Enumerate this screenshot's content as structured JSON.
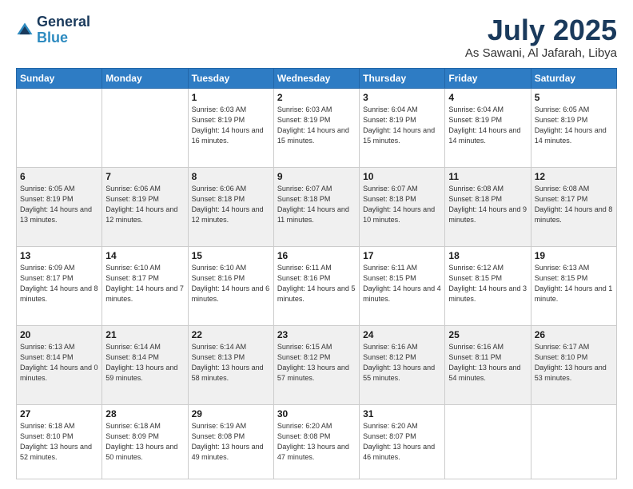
{
  "header": {
    "logo_line1": "General",
    "logo_line2": "Blue",
    "month": "July 2025",
    "location": "As Sawani, Al Jafarah, Libya"
  },
  "days_of_week": [
    "Sunday",
    "Monday",
    "Tuesday",
    "Wednesday",
    "Thursday",
    "Friday",
    "Saturday"
  ],
  "weeks": [
    [
      {
        "day": "",
        "empty": true
      },
      {
        "day": "",
        "empty": true
      },
      {
        "day": "1",
        "sunrise": "Sunrise: 6:03 AM",
        "sunset": "Sunset: 8:19 PM",
        "daylight": "Daylight: 14 hours and 16 minutes."
      },
      {
        "day": "2",
        "sunrise": "Sunrise: 6:03 AM",
        "sunset": "Sunset: 8:19 PM",
        "daylight": "Daylight: 14 hours and 15 minutes."
      },
      {
        "day": "3",
        "sunrise": "Sunrise: 6:04 AM",
        "sunset": "Sunset: 8:19 PM",
        "daylight": "Daylight: 14 hours and 15 minutes."
      },
      {
        "day": "4",
        "sunrise": "Sunrise: 6:04 AM",
        "sunset": "Sunset: 8:19 PM",
        "daylight": "Daylight: 14 hours and 14 minutes."
      },
      {
        "day": "5",
        "sunrise": "Sunrise: 6:05 AM",
        "sunset": "Sunset: 8:19 PM",
        "daylight": "Daylight: 14 hours and 14 minutes."
      }
    ],
    [
      {
        "day": "6",
        "sunrise": "Sunrise: 6:05 AM",
        "sunset": "Sunset: 8:19 PM",
        "daylight": "Daylight: 14 hours and 13 minutes."
      },
      {
        "day": "7",
        "sunrise": "Sunrise: 6:06 AM",
        "sunset": "Sunset: 8:19 PM",
        "daylight": "Daylight: 14 hours and 12 minutes."
      },
      {
        "day": "8",
        "sunrise": "Sunrise: 6:06 AM",
        "sunset": "Sunset: 8:18 PM",
        "daylight": "Daylight: 14 hours and 12 minutes."
      },
      {
        "day": "9",
        "sunrise": "Sunrise: 6:07 AM",
        "sunset": "Sunset: 8:18 PM",
        "daylight": "Daylight: 14 hours and 11 minutes."
      },
      {
        "day": "10",
        "sunrise": "Sunrise: 6:07 AM",
        "sunset": "Sunset: 8:18 PM",
        "daylight": "Daylight: 14 hours and 10 minutes."
      },
      {
        "day": "11",
        "sunrise": "Sunrise: 6:08 AM",
        "sunset": "Sunset: 8:18 PM",
        "daylight": "Daylight: 14 hours and 9 minutes."
      },
      {
        "day": "12",
        "sunrise": "Sunrise: 6:08 AM",
        "sunset": "Sunset: 8:17 PM",
        "daylight": "Daylight: 14 hours and 8 minutes."
      }
    ],
    [
      {
        "day": "13",
        "sunrise": "Sunrise: 6:09 AM",
        "sunset": "Sunset: 8:17 PM",
        "daylight": "Daylight: 14 hours and 8 minutes."
      },
      {
        "day": "14",
        "sunrise": "Sunrise: 6:10 AM",
        "sunset": "Sunset: 8:17 PM",
        "daylight": "Daylight: 14 hours and 7 minutes."
      },
      {
        "day": "15",
        "sunrise": "Sunrise: 6:10 AM",
        "sunset": "Sunset: 8:16 PM",
        "daylight": "Daylight: 14 hours and 6 minutes."
      },
      {
        "day": "16",
        "sunrise": "Sunrise: 6:11 AM",
        "sunset": "Sunset: 8:16 PM",
        "daylight": "Daylight: 14 hours and 5 minutes."
      },
      {
        "day": "17",
        "sunrise": "Sunrise: 6:11 AM",
        "sunset": "Sunset: 8:15 PM",
        "daylight": "Daylight: 14 hours and 4 minutes."
      },
      {
        "day": "18",
        "sunrise": "Sunrise: 6:12 AM",
        "sunset": "Sunset: 8:15 PM",
        "daylight": "Daylight: 14 hours and 3 minutes."
      },
      {
        "day": "19",
        "sunrise": "Sunrise: 6:13 AM",
        "sunset": "Sunset: 8:15 PM",
        "daylight": "Daylight: 14 hours and 1 minute."
      }
    ],
    [
      {
        "day": "20",
        "sunrise": "Sunrise: 6:13 AM",
        "sunset": "Sunset: 8:14 PM",
        "daylight": "Daylight: 14 hours and 0 minutes."
      },
      {
        "day": "21",
        "sunrise": "Sunrise: 6:14 AM",
        "sunset": "Sunset: 8:14 PM",
        "daylight": "Daylight: 13 hours and 59 minutes."
      },
      {
        "day": "22",
        "sunrise": "Sunrise: 6:14 AM",
        "sunset": "Sunset: 8:13 PM",
        "daylight": "Daylight: 13 hours and 58 minutes."
      },
      {
        "day": "23",
        "sunrise": "Sunrise: 6:15 AM",
        "sunset": "Sunset: 8:12 PM",
        "daylight": "Daylight: 13 hours and 57 minutes."
      },
      {
        "day": "24",
        "sunrise": "Sunrise: 6:16 AM",
        "sunset": "Sunset: 8:12 PM",
        "daylight": "Daylight: 13 hours and 55 minutes."
      },
      {
        "day": "25",
        "sunrise": "Sunrise: 6:16 AM",
        "sunset": "Sunset: 8:11 PM",
        "daylight": "Daylight: 13 hours and 54 minutes."
      },
      {
        "day": "26",
        "sunrise": "Sunrise: 6:17 AM",
        "sunset": "Sunset: 8:10 PM",
        "daylight": "Daylight: 13 hours and 53 minutes."
      }
    ],
    [
      {
        "day": "27",
        "sunrise": "Sunrise: 6:18 AM",
        "sunset": "Sunset: 8:10 PM",
        "daylight": "Daylight: 13 hours and 52 minutes."
      },
      {
        "day": "28",
        "sunrise": "Sunrise: 6:18 AM",
        "sunset": "Sunset: 8:09 PM",
        "daylight": "Daylight: 13 hours and 50 minutes."
      },
      {
        "day": "29",
        "sunrise": "Sunrise: 6:19 AM",
        "sunset": "Sunset: 8:08 PM",
        "daylight": "Daylight: 13 hours and 49 minutes."
      },
      {
        "day": "30",
        "sunrise": "Sunrise: 6:20 AM",
        "sunset": "Sunset: 8:08 PM",
        "daylight": "Daylight: 13 hours and 47 minutes."
      },
      {
        "day": "31",
        "sunrise": "Sunrise: 6:20 AM",
        "sunset": "Sunset: 8:07 PM",
        "daylight": "Daylight: 13 hours and 46 minutes."
      },
      {
        "day": "",
        "empty": true
      },
      {
        "day": "",
        "empty": true
      }
    ]
  ]
}
